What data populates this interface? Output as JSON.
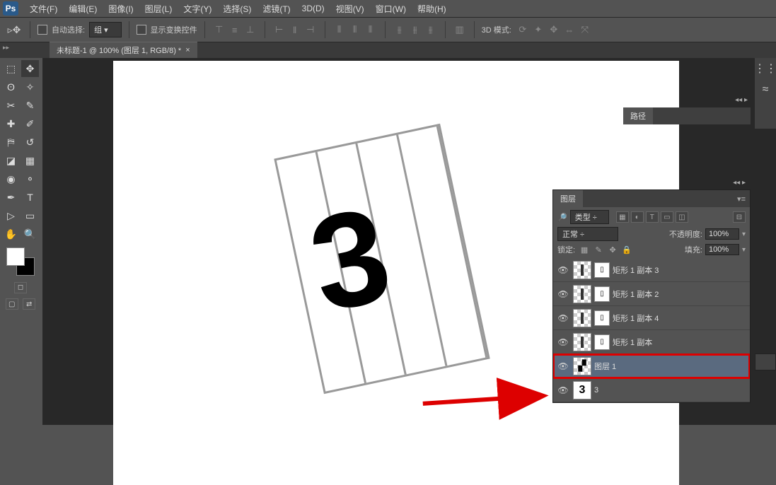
{
  "app": {
    "logo_text": "Ps"
  },
  "menu": {
    "file": "文件(F)",
    "edit": "编辑(E)",
    "image": "图像(I)",
    "layer": "图层(L)",
    "type": "文字(Y)",
    "select": "选择(S)",
    "filter": "滤镜(T)",
    "threed": "3D(D)",
    "view": "视图(V)",
    "window": "窗口(W)",
    "help": "帮助(H)"
  },
  "options": {
    "auto_select": "自动选择:",
    "group": "组",
    "show_transform": "显示变换控件",
    "mode3d": "3D 模式:"
  },
  "doc": {
    "tab_title": "未标题-1 @ 100% (图层 1, RGB/8) *"
  },
  "panels": {
    "paths_tab": "路径",
    "layers_tab": "图层",
    "kind_label": "类型",
    "blend_mode": "正常",
    "opacity_label": "不透明度:",
    "opacity_value": "100%",
    "lock_label": "锁定:",
    "fill_label": "填充:",
    "fill_value": "100%"
  },
  "layers": [
    {
      "name": "矩形 1 副本 3",
      "selected": false
    },
    {
      "name": "矩形 1 副本 2",
      "selected": false
    },
    {
      "name": "矩形 1 副本 4",
      "selected": false
    },
    {
      "name": "矩形 1 副本",
      "selected": false
    },
    {
      "name": "图层 1",
      "selected": true
    },
    {
      "name": "3",
      "selected": false
    }
  ],
  "canvas": {
    "big_number": "3"
  }
}
